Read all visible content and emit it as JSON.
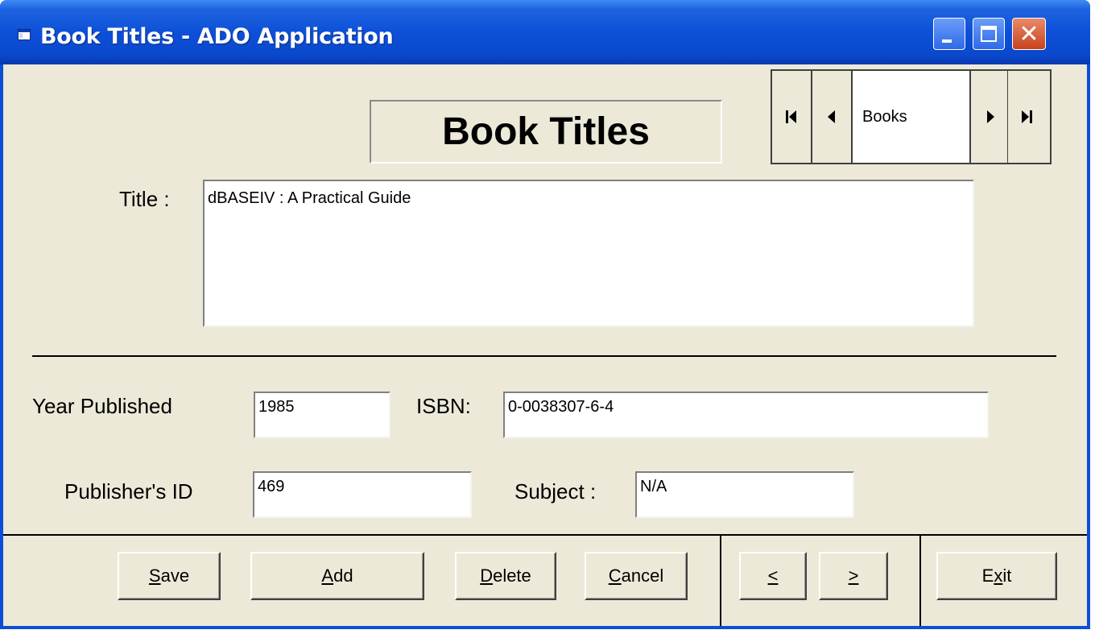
{
  "window": {
    "title": "Book Titles - ADO Application",
    "controls": {
      "minimize": "minimize",
      "maximize": "maximize",
      "close": "✕"
    }
  },
  "form": {
    "heading": "Book Titles",
    "data_control": {
      "caption": "Books"
    },
    "title_label": "Title :",
    "title_value": "dBASEIV : A Practical Guide",
    "year_label": "Year Published",
    "year_value": "1985",
    "isbn_label": "ISBN:",
    "isbn_value": "0-0038307-6-4",
    "publisher_label": "Publisher's ID",
    "publisher_value": "469",
    "subject_label": "Subject :",
    "subject_value": "N/A"
  },
  "buttons": {
    "save": {
      "access": "S",
      "rest": "ave"
    },
    "add": {
      "access": "A",
      "rest": "dd"
    },
    "delete": {
      "access": "D",
      "rest": "elete"
    },
    "cancel": {
      "access": "C",
      "rest": "ancel"
    },
    "prev": {
      "access": "<"
    },
    "next": {
      "access": ">"
    },
    "exit": {
      "pre": "E",
      "access": "x",
      "rest": "it"
    }
  }
}
